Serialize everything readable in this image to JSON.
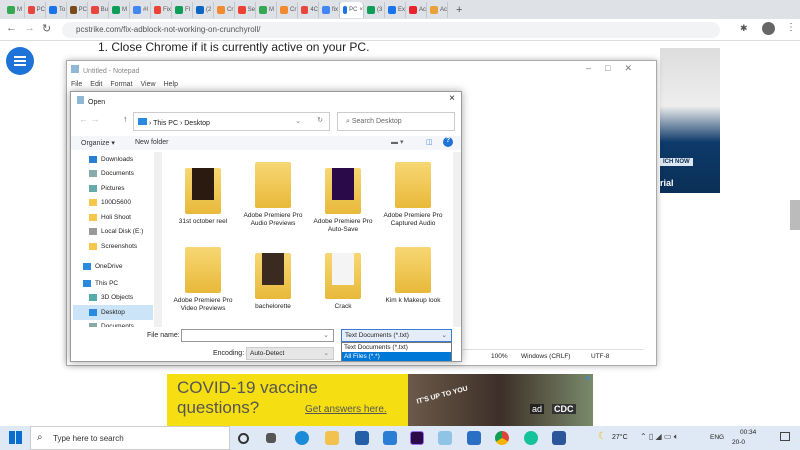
{
  "browser": {
    "tabs": [
      "M",
      "PC",
      "To",
      "PC",
      "Bu",
      "M",
      "#I",
      "Fix",
      "FI",
      "(2",
      "Cr",
      "Se",
      "M",
      "Cr",
      "4C",
      "fix",
      "PC",
      "(3",
      "Ex",
      "Ac",
      "Ac"
    ],
    "active_tab_close": "×",
    "new_tab": "+",
    "url": "pcstrike.com/fix-adblock-not-working-on-crunchyroll/"
  },
  "page": {
    "heading": "1. Close Chrome if it is currently active on your PC.",
    "side_ad_button": "ICH NOW",
    "side_ad_text": "rial"
  },
  "notepad": {
    "title": "Untitled - Notepad",
    "menu": [
      "File",
      "Edit",
      "Format",
      "View",
      "Help"
    ],
    "status": {
      "zoom": "100%",
      "line_ending": "Windows (CRLF)",
      "encoding": "UTF-8"
    }
  },
  "dialog": {
    "title": "Open",
    "close": "×",
    "breadcrumb": [
      "This PC",
      "Desktop"
    ],
    "search_placeholder": "Search Desktop",
    "organize": "Organize ▾",
    "new_folder": "New folder",
    "nav": [
      "Downloads",
      "Documents",
      "Pictures",
      "100D5600",
      "Holi Shoot",
      "Local Disk (E:)",
      "Screenshots",
      "OneDrive",
      "This PC",
      "3D Objects",
      "Desktop",
      "Documents"
    ],
    "files": [
      "31st october reel",
      "Adobe Premiere Pro Audio Previews",
      "Adobe Premiere Pro Auto-Save",
      "Adobe Premiere Pro Captured Audio",
      "Adobe Premiere Pro Video Previews",
      "bachelorette",
      "Crack",
      "Kim k Makeup look"
    ],
    "file_name_label": "File name:",
    "file_name_value": "",
    "encoding_label": "Encoding:",
    "encoding_value": "Auto-Detect",
    "filter_value": "Text Documents (*.txt)",
    "filter_options": [
      "Text Documents (*.txt)",
      "All Files  (*.*)"
    ]
  },
  "ad": {
    "line1": "COVID-19 vaccine",
    "line2": "questions?",
    "link": "Get answers here.",
    "badge1": "ad",
    "badge2": "CDC",
    "slogan": "IT'S UP TO YOU"
  },
  "taskbar": {
    "search_placeholder": "Type here to search",
    "weather": "27°C",
    "lang": "ENG",
    "time": "00:34",
    "date": "20-0"
  },
  "colors": {
    "accent": "#1e73d8",
    "ad_yellow": "#f5de12",
    "selection": "#0078d7"
  }
}
